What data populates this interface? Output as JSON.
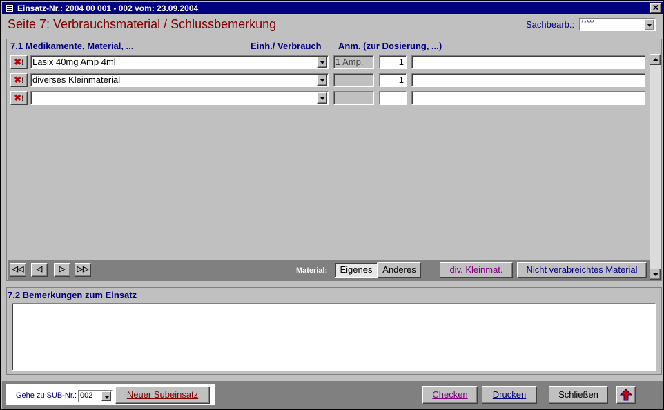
{
  "window": {
    "title": "Einsatz-Nr.: 2004 00 001 - 002    vom: 23.09.2004",
    "close_glyph": "✕"
  },
  "header": {
    "page_title": "Seite 7: Verbrauchsmaterial / Schlussbemerkung",
    "sachbearb_label": "Sachbearb.:",
    "sachbearb_value": "*****"
  },
  "section1": {
    "heading": "7.1  Medikamente, Material, ...",
    "col_unit": "Einh./ Verbrauch",
    "col_note": "Anm. (zur Dosierung, ...)",
    "rows": [
      {
        "item": "Lasix 40mg Amp 4ml",
        "unit": "1 Amp.",
        "qty": "1",
        "note": ""
      },
      {
        "item": "diverses Kleinmaterial",
        "unit": "",
        "qty": "1",
        "note": ""
      },
      {
        "item": "",
        "unit": "",
        "qty": "",
        "note": ""
      }
    ],
    "delete_glyph": "✖",
    "delete_bang": "!"
  },
  "navbar": {
    "first": "◁◁",
    "prev": "◁",
    "next": "▷",
    "last": "▷▷",
    "material_label": "Material:",
    "eigenes": "Eigenes",
    "anderes": "Anderes",
    "div_kleinmat": "div. Kleinmat.",
    "nicht_verabreicht": "Nicht verabreichtes Material"
  },
  "section2": {
    "heading": "7.2  Bemerkungen zum Einsatz",
    "remarks_value": ""
  },
  "footer": {
    "gehe_label": "Gehe zu SUB-Nr.:",
    "sub_value": "002",
    "neuer_subeinsatz": "Neuer Subeinsatz",
    "checken": "Checken",
    "drucken": "Drucken",
    "schliessen": "Schließen"
  },
  "colors": {
    "title_bg": "#000080",
    "page_title": "#800000",
    "section_heading": "#000080",
    "delete_icon": "#c00000",
    "div_kleinmat_text": "#800080",
    "nicht_verabreicht_text": "#000080",
    "up_arrow_icon": "#cc0000"
  }
}
